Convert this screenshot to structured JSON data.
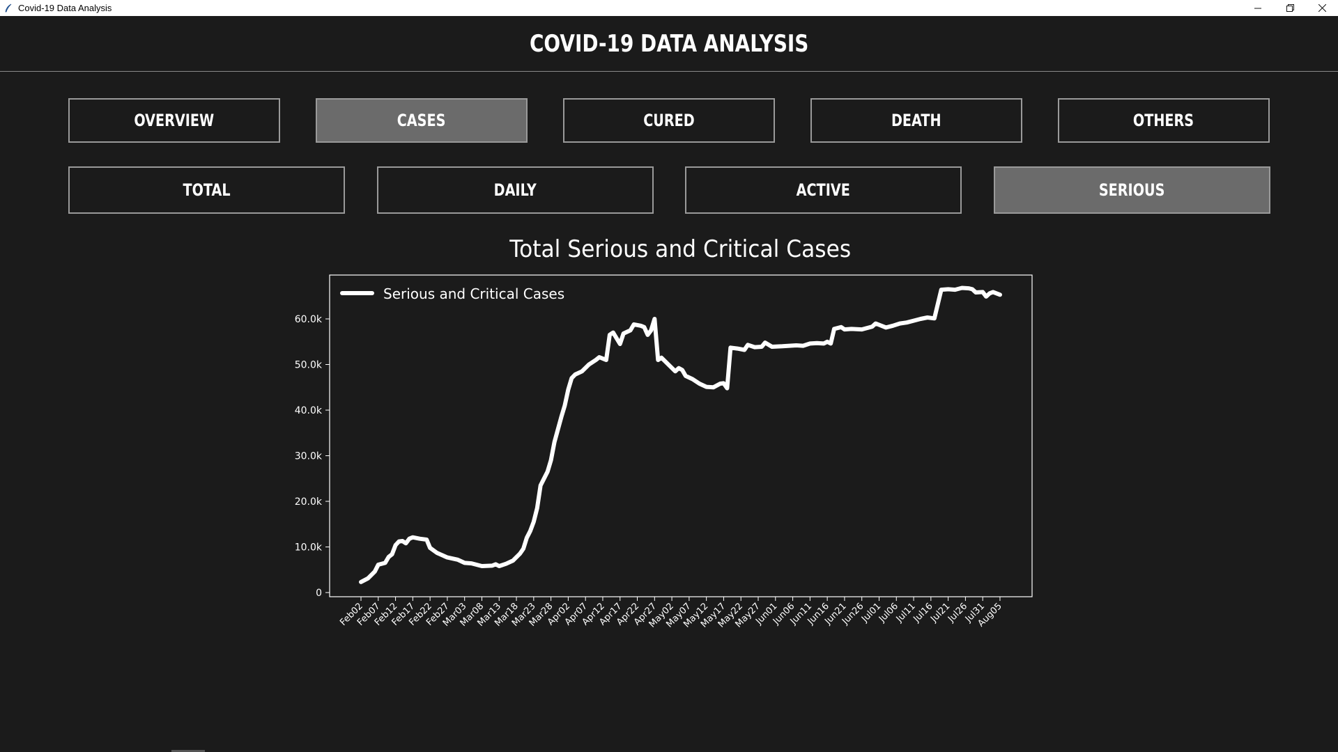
{
  "window": {
    "title": "Covid-19 Data Analysis",
    "minimize_icon": "minimize-icon",
    "maximize_icon": "restore-icon",
    "close_icon": "close-icon"
  },
  "header": {
    "title": "COVID-19 DATA ANALYSIS"
  },
  "main_tabs": [
    {
      "label": "OVERVIEW",
      "active": false
    },
    {
      "label": "CASES",
      "active": true
    },
    {
      "label": "CURED",
      "active": false
    },
    {
      "label": "DEATH",
      "active": false
    },
    {
      "label": "OTHERS",
      "active": false
    }
  ],
  "sub_tabs": [
    {
      "label": "TOTAL",
      "active": false
    },
    {
      "label": "DAILY",
      "active": false
    },
    {
      "label": "ACTIVE",
      "active": false
    },
    {
      "label": "SERIOUS",
      "active": true
    }
  ],
  "colors": {
    "background": "#1b1b1b",
    "active_tab": "#6b6b6b",
    "line": "#ffffff",
    "border": "#9a9a9a"
  },
  "chart_data": {
    "type": "line",
    "title": "Total Serious and Critical Cases",
    "xlabel": "",
    "ylabel": "",
    "legend_position": "top-left",
    "grid": false,
    "ylim": [
      0,
      68000
    ],
    "ytick_labels": [
      "0",
      "10.0k",
      "20.0k",
      "30.0k",
      "40.0k",
      "50.0k",
      "60.0k"
    ],
    "ytick_values": [
      0,
      10000,
      20000,
      30000,
      40000,
      50000,
      60000
    ],
    "xtick_labels": [
      "Feb02",
      "Feb07",
      "Feb12",
      "Feb17",
      "Feb22",
      "Feb27",
      "Mar03",
      "Mar08",
      "Mar13",
      "Mar18",
      "Mar23",
      "Mar28",
      "Apr02",
      "Apr07",
      "Apr12",
      "Apr17",
      "Apr22",
      "Apr27",
      "May02",
      "May07",
      "May12",
      "May17",
      "May22",
      "May27",
      "Jun01",
      "Jun06",
      "Jun11",
      "Jun16",
      "Jun21",
      "Jun26",
      "Jul01",
      "Jul06",
      "Jul11",
      "Jul16",
      "Jul21",
      "Jul26",
      "Jul31",
      "Aug05"
    ],
    "series": [
      {
        "name": "Serious and Critical Cases",
        "color": "#ffffff",
        "points": [
          [
            "Feb02",
            2300
          ],
          [
            "Feb04",
            3100
          ],
          [
            "Feb06",
            4600
          ],
          [
            "Feb07",
            6100
          ],
          [
            "Feb09",
            6500
          ],
          [
            "Feb10",
            7800
          ],
          [
            "Feb11",
            8400
          ],
          [
            "Feb12",
            10400
          ],
          [
            "Feb13",
            11200
          ],
          [
            "Feb14",
            11300
          ],
          [
            "Feb15",
            10800
          ],
          [
            "Feb16",
            11800
          ],
          [
            "Feb17",
            12100
          ],
          [
            "Feb19",
            11800
          ],
          [
            "Feb21",
            11600
          ],
          [
            "Feb22",
            9800
          ],
          [
            "Feb24",
            8700
          ],
          [
            "Feb27",
            7700
          ],
          [
            "Mar01",
            7200
          ],
          [
            "Mar03",
            6500
          ],
          [
            "Mar05",
            6400
          ],
          [
            "Mar08",
            5800
          ],
          [
            "Mar11",
            5900
          ],
          [
            "Mar12",
            6200
          ],
          [
            "Mar13",
            5800
          ],
          [
            "Mar15",
            6300
          ],
          [
            "Mar17",
            7000
          ],
          [
            "Mar19",
            8500
          ],
          [
            "Mar20",
            9600
          ],
          [
            "Mar21",
            12000
          ],
          [
            "Mar22",
            13500
          ],
          [
            "Mar23",
            15500
          ],
          [
            "Mar24",
            18500
          ],
          [
            "Mar25",
            23500
          ],
          [
            "Mar27",
            26500
          ],
          [
            "Mar28",
            29000
          ],
          [
            "Mar29",
            33000
          ],
          [
            "Mar31",
            38500
          ],
          [
            "Apr01",
            41000
          ],
          [
            "Apr02",
            44500
          ],
          [
            "Apr03",
            47000
          ],
          [
            "Apr04",
            47800
          ],
          [
            "Apr06",
            48500
          ],
          [
            "Apr08",
            50000
          ],
          [
            "Apr10",
            51000
          ],
          [
            "Apr11",
            51600
          ],
          [
            "Apr12",
            51300
          ],
          [
            "Apr13",
            51000
          ],
          [
            "Apr14",
            56500
          ],
          [
            "Apr15",
            57000
          ],
          [
            "Apr17",
            54500
          ],
          [
            "Apr18",
            56800
          ],
          [
            "Apr20",
            57500
          ],
          [
            "Apr21",
            58800
          ],
          [
            "Apr23",
            58500
          ],
          [
            "Apr24",
            58200
          ],
          [
            "Apr25",
            56500
          ],
          [
            "Apr26",
            57500
          ],
          [
            "Apr27",
            60000
          ],
          [
            "Apr28",
            51000
          ],
          [
            "Apr29",
            51500
          ],
          [
            "May01",
            50000
          ],
          [
            "May03",
            48500
          ],
          [
            "May04",
            49200
          ],
          [
            "May05",
            48800
          ],
          [
            "May06",
            47500
          ],
          [
            "May08",
            46800
          ],
          [
            "May10",
            45800
          ],
          [
            "May12",
            45100
          ],
          [
            "May14",
            45000
          ],
          [
            "May16",
            45800
          ],
          [
            "May17",
            45900
          ],
          [
            "May18",
            44800
          ],
          [
            "May19",
            53700
          ],
          [
            "May21",
            53500
          ],
          [
            "May23",
            53200
          ],
          [
            "May24",
            54300
          ],
          [
            "May26",
            53800
          ],
          [
            "May28",
            53900
          ],
          [
            "May29",
            54800
          ],
          [
            "May31",
            53900
          ],
          [
            "Jun03",
            54000
          ],
          [
            "Jun05",
            54100
          ],
          [
            "Jun07",
            54200
          ],
          [
            "Jun09",
            54100
          ],
          [
            "Jun11",
            54600
          ],
          [
            "Jun13",
            54700
          ],
          [
            "Jun15",
            54600
          ],
          [
            "Jun16",
            55000
          ],
          [
            "Jun17",
            54600
          ],
          [
            "Jun18",
            57800
          ],
          [
            "Jun20",
            58200
          ],
          [
            "Jun21",
            57700
          ],
          [
            "Jun23",
            57800
          ],
          [
            "Jun26",
            57700
          ],
          [
            "Jun29",
            58300
          ],
          [
            "Jun30",
            59000
          ],
          [
            "Jul01",
            58700
          ],
          [
            "Jul03",
            58100
          ],
          [
            "Jul05",
            58500
          ],
          [
            "Jul07",
            59000
          ],
          [
            "Jul09",
            59200
          ],
          [
            "Jul11",
            59600
          ],
          [
            "Jul13",
            60000
          ],
          [
            "Jul15",
            60300
          ],
          [
            "Jul17",
            60100
          ],
          [
            "Jul19",
            66400
          ],
          [
            "Jul21",
            66500
          ],
          [
            "Jul23",
            66400
          ],
          [
            "Jul25",
            66800
          ],
          [
            "Jul27",
            66700
          ],
          [
            "Jul28",
            66500
          ],
          [
            "Jul29",
            65800
          ],
          [
            "Jul31",
            65900
          ],
          [
            "Aug01",
            64900
          ],
          [
            "Aug02",
            65600
          ],
          [
            "Aug03",
            65900
          ],
          [
            "Aug05",
            65300
          ]
        ]
      }
    ]
  }
}
